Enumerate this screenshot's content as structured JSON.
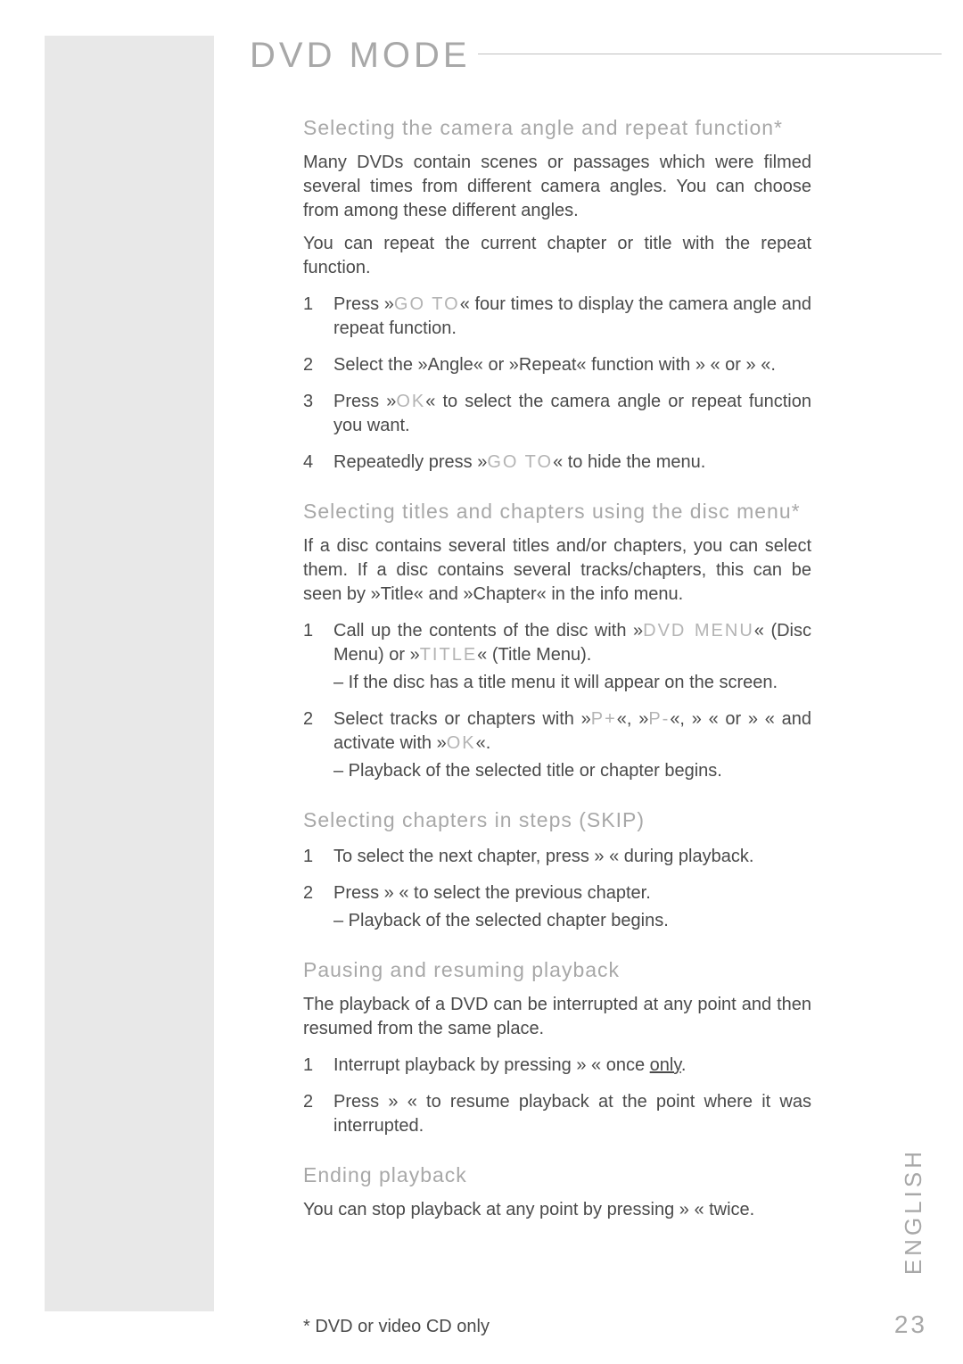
{
  "title": "DVD MODE",
  "section1": {
    "heading": "Selecting the camera angle and repeat function*",
    "para1": "Many DVDs contain scenes or passages which were filmed several times from different camera angles. You can choose from among these different angles.",
    "para2": "You can repeat the current chapter or title with the repeat function.",
    "steps": {
      "s1a": "Press »",
      "s1b": "GO TO",
      "s1c": "« four times to display the camera angle and repeat function.",
      "s2": "Select the »Angle« or »Repeat« function with »   « or »   «.",
      "s3a": "Press »",
      "s3b": "OK",
      "s3c": "« to select the camera angle or repeat function you want.",
      "s4a": "Repeatedly press »",
      "s4b": "GO TO",
      "s4c": "« to hide the menu."
    }
  },
  "section2": {
    "heading": "Selecting titles and chapters using the disc menu*",
    "para1": "If a disc contains several titles and/or chapters, you can select them. If a disc contains several tracks/chapters, this can be seen by »Title« and »Chapter« in the info menu.",
    "steps": {
      "s1a": "Call up the contents of the disc with »",
      "s1b": "DVD MENU",
      "s1c": "« (Disc Menu) or »",
      "s1d": "TITLE",
      "s1e": "« (Title Menu).",
      "s1note": "– If the disc has a title menu it will appear on the screen.",
      "s2a": "Select tracks or chapters with »",
      "s2b": "P+",
      "s2c": "«, »",
      "s2d": "P-",
      "s2e": "«, »   « or »   « and activate with »",
      "s2f": "OK",
      "s2g": "«.",
      "s2note": "– Playback of the selected title or chapter begins."
    }
  },
  "section3": {
    "heading": "Selecting chapters in steps (SKIP)",
    "steps": {
      "s1": "To select the next chapter, press »    « during playback.",
      "s2": "Press »    « to select the previous chapter.",
      "s2note": "– Playback of the selected chapter begins."
    }
  },
  "section4": {
    "heading": "Pausing and resuming playback",
    "para1": "The playback of a DVD can be interrupted at any point and then resumed from the same place.",
    "steps": {
      "s1a": "Interrupt playback by pressing »   « once ",
      "s1u": "only",
      "s1b": ".",
      "s2": "Press »    « to resume playback at the point where it was interrupted."
    }
  },
  "section5": {
    "heading": "Ending playback",
    "para1": "You can stop playback at any point by pressing »   « twice."
  },
  "footnote": "* DVD or video CD only",
  "lang": "ENGLISH",
  "page_num": "23"
}
